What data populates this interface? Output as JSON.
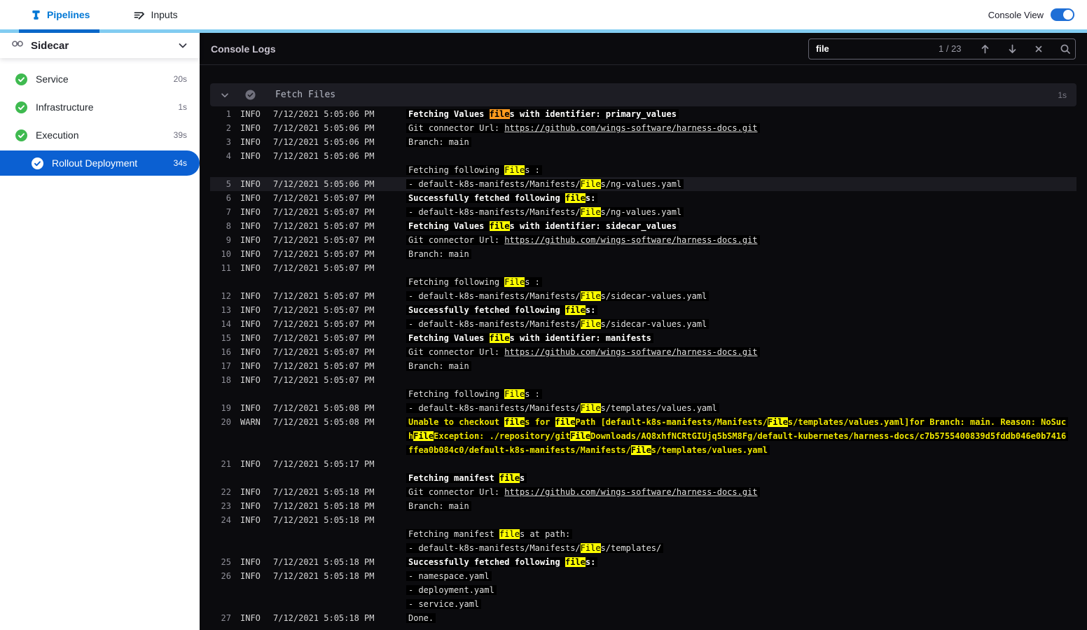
{
  "topnav": {
    "tabs": [
      {
        "label": "Pipelines",
        "active": true
      },
      {
        "label": "Inputs",
        "active": false
      }
    ],
    "console_view_label": "Console View",
    "console_view_on": true
  },
  "sidebar": {
    "stage_label": "Sidecar",
    "steps": [
      {
        "label": "Service",
        "duration": "20s",
        "status": "success",
        "selected": false
      },
      {
        "label": "Infrastructure",
        "duration": "1s",
        "status": "success",
        "selected": false
      },
      {
        "label": "Execution",
        "duration": "39s",
        "status": "success",
        "selected": false
      },
      {
        "label": "Rollout Deployment",
        "duration": "34s",
        "status": "success",
        "selected": true
      }
    ]
  },
  "console": {
    "title": "Console Logs",
    "search": {
      "value": "file",
      "counter": "1 / 23",
      "icons": [
        "arrow-up-icon",
        "arrow-down-icon",
        "close-icon",
        "search-icon"
      ]
    },
    "section": {
      "title": "Fetch Files",
      "duration": "1s",
      "status": "success"
    },
    "colors": {
      "accent_blue": "#0278d5",
      "selected_step_blue": "#0b60d2",
      "success_green": "#3fba50",
      "console_bg": "#0b0b0e",
      "match_highlight_bg": "#ffff00",
      "current_match_bg": "#ff9a1e",
      "warn_text": "#efe600",
      "strip_light_blue": "#83cdf2",
      "strip_active_blue": "#0b68ca"
    },
    "lines": [
      {
        "n": 1,
        "lvl": "INFO",
        "t": "7/12/2021 5:05:06 PM",
        "rows": [
          {
            "b": 1,
            "parts": [
              "Fetching Values ",
              {
                "t": "file",
                "h": "c"
              },
              "s with identifier: primary_values"
            ]
          }
        ]
      },
      {
        "n": 2,
        "lvl": "INFO",
        "t": "7/12/2021 5:05:06 PM",
        "rows": [
          {
            "parts": [
              "Git connector Url: ",
              {
                "t": "https://github.com/wings-software/harness-docs.git",
                "l": 1
              }
            ]
          }
        ]
      },
      {
        "n": 3,
        "lvl": "INFO",
        "t": "7/12/2021 5:05:06 PM",
        "rows": [
          {
            "parts": [
              "Branch: main"
            ]
          }
        ]
      },
      {
        "n": 4,
        "lvl": "INFO",
        "t": "7/12/2021 5:05:06 PM",
        "rows": [
          {
            "parts": []
          },
          {
            "parts": [
              "Fetching following ",
              {
                "t": "File",
                "h": "m"
              },
              "s :"
            ]
          }
        ]
      },
      {
        "n": 5,
        "lvl": "INFO",
        "t": "7/12/2021 5:05:06 PM",
        "sel": 1,
        "rows": [
          {
            "parts": [
              "- default-k8s-manifests/Manifests/",
              {
                "t": "File",
                "h": "m"
              },
              "s/ng-values.yaml"
            ]
          }
        ]
      },
      {
        "n": 6,
        "lvl": "INFO",
        "t": "7/12/2021 5:05:07 PM",
        "rows": [
          {
            "b": 1,
            "parts": [
              "Successfully fetched following ",
              {
                "t": "file",
                "h": "m"
              },
              "s:"
            ]
          }
        ]
      },
      {
        "n": 7,
        "lvl": "INFO",
        "t": "7/12/2021 5:05:07 PM",
        "rows": [
          {
            "parts": [
              "- default-k8s-manifests/Manifests/",
              {
                "t": "File",
                "h": "m"
              },
              "s/ng-values.yaml"
            ]
          }
        ]
      },
      {
        "n": 8,
        "lvl": "INFO",
        "t": "7/12/2021 5:05:07 PM",
        "rows": [
          {
            "b": 1,
            "parts": [
              "Fetching Values ",
              {
                "t": "file",
                "h": "m"
              },
              "s with identifier: sidecar_values"
            ]
          }
        ]
      },
      {
        "n": 9,
        "lvl": "INFO",
        "t": "7/12/2021 5:05:07 PM",
        "rows": [
          {
            "parts": [
              "Git connector Url: ",
              {
                "t": "https://github.com/wings-software/harness-docs.git",
                "l": 1
              }
            ]
          }
        ]
      },
      {
        "n": 10,
        "lvl": "INFO",
        "t": "7/12/2021 5:05:07 PM",
        "rows": [
          {
            "parts": [
              "Branch: main"
            ]
          }
        ]
      },
      {
        "n": 11,
        "lvl": "INFO",
        "t": "7/12/2021 5:05:07 PM",
        "rows": [
          {
            "parts": []
          },
          {
            "parts": [
              "Fetching following ",
              {
                "t": "File",
                "h": "m"
              },
              "s :"
            ]
          }
        ]
      },
      {
        "n": 12,
        "lvl": "INFO",
        "t": "7/12/2021 5:05:07 PM",
        "rows": [
          {
            "parts": [
              "- default-k8s-manifests/Manifests/",
              {
                "t": "File",
                "h": "m"
              },
              "s/sidecar-values.yaml"
            ]
          }
        ]
      },
      {
        "n": 13,
        "lvl": "INFO",
        "t": "7/12/2021 5:05:07 PM",
        "rows": [
          {
            "b": 1,
            "parts": [
              "Successfully fetched following ",
              {
                "t": "file",
                "h": "m"
              },
              "s:"
            ]
          }
        ]
      },
      {
        "n": 14,
        "lvl": "INFO",
        "t": "7/12/2021 5:05:07 PM",
        "rows": [
          {
            "parts": [
              "- default-k8s-manifests/Manifests/",
              {
                "t": "File",
                "h": "m"
              },
              "s/sidecar-values.yaml"
            ]
          }
        ]
      },
      {
        "n": 15,
        "lvl": "INFO",
        "t": "7/12/2021 5:05:07 PM",
        "rows": [
          {
            "b": 1,
            "parts": [
              "Fetching Values ",
              {
                "t": "file",
                "h": "m"
              },
              "s with identifier: manifests"
            ]
          }
        ]
      },
      {
        "n": 16,
        "lvl": "INFO",
        "t": "7/12/2021 5:05:07 PM",
        "rows": [
          {
            "parts": [
              "Git connector Url: ",
              {
                "t": "https://github.com/wings-software/harness-docs.git",
                "l": 1
              }
            ]
          }
        ]
      },
      {
        "n": 17,
        "lvl": "INFO",
        "t": "7/12/2021 5:05:07 PM",
        "rows": [
          {
            "parts": [
              "Branch: main"
            ]
          }
        ]
      },
      {
        "n": 18,
        "lvl": "INFO",
        "t": "7/12/2021 5:05:07 PM",
        "rows": [
          {
            "parts": []
          },
          {
            "parts": [
              "Fetching following ",
              {
                "t": "File",
                "h": "m"
              },
              "s :"
            ]
          }
        ]
      },
      {
        "n": 19,
        "lvl": "INFO",
        "t": "7/12/2021 5:05:08 PM",
        "rows": [
          {
            "parts": [
              "- default-k8s-manifests/Manifests/",
              {
                "t": "File",
                "h": "m"
              },
              "s/templates/values.yaml"
            ]
          }
        ]
      },
      {
        "n": 20,
        "lvl": "WARN",
        "t": "7/12/2021 5:05:08 PM",
        "rows": [
          {
            "w": 1,
            "parts": [
              "Unable to checkout ",
              {
                "t": "file",
                "h": "m"
              },
              "s for ",
              {
                "t": "file",
                "h": "m"
              },
              "Path [default-k8s-manifests/Manifests/",
              {
                "t": "File",
                "h": "m"
              },
              "s/templates/values.yaml]for Branch: main. Reason: NoSuch",
              {
                "t": "File",
                "h": "m"
              },
              "Exception: ./repository/git",
              {
                "t": "File",
                "h": "m"
              },
              "Downloads/AQ8xhfNCRtGIUjq5bSM8Fg/default-kubernetes/harness-docs/c7b5755400839d5fddb046e0b7416ffea0b084c0/default-k8s-manifests/Manifests/",
              {
                "t": "File",
                "h": "m"
              },
              "s/templates/values.yaml"
            ]
          }
        ]
      },
      {
        "n": 21,
        "lvl": "INFO",
        "t": "7/12/2021 5:05:17 PM",
        "rows": [
          {
            "parts": []
          },
          {
            "b": 1,
            "parts": [
              "Fetching manifest ",
              {
                "t": "file",
                "h": "m"
              },
              "s"
            ]
          }
        ]
      },
      {
        "n": 22,
        "lvl": "INFO",
        "t": "7/12/2021 5:05:18 PM",
        "rows": [
          {
            "parts": [
              "Git connector Url: ",
              {
                "t": "https://github.com/wings-software/harness-docs.git",
                "l": 1
              }
            ]
          }
        ]
      },
      {
        "n": 23,
        "lvl": "INFO",
        "t": "7/12/2021 5:05:18 PM",
        "rows": [
          {
            "parts": [
              "Branch: main"
            ]
          }
        ]
      },
      {
        "n": 24,
        "lvl": "INFO",
        "t": "7/12/2021 5:05:18 PM",
        "rows": [
          {
            "parts": []
          },
          {
            "parts": [
              "Fetching manifest ",
              {
                "t": "file",
                "h": "m"
              },
              "s at path:"
            ]
          },
          {
            "parts": [
              "- default-k8s-manifests/Manifests/",
              {
                "t": "File",
                "h": "m"
              },
              "s/templates/"
            ]
          }
        ]
      },
      {
        "n": 25,
        "lvl": "INFO",
        "t": "7/12/2021 5:05:18 PM",
        "rows": [
          {
            "b": 1,
            "parts": [
              "Successfully fetched following ",
              {
                "t": "file",
                "h": "m"
              },
              "s:"
            ]
          }
        ]
      },
      {
        "n": 26,
        "lvl": "INFO",
        "t": "7/12/2021 5:05:18 PM",
        "rows": [
          {
            "parts": [
              "- namespace.yaml"
            ]
          },
          {
            "parts": [
              "- deployment.yaml"
            ]
          },
          {
            "parts": [
              "- service.yaml"
            ]
          }
        ]
      },
      {
        "n": 27,
        "lvl": "INFO",
        "t": "7/12/2021 5:05:18 PM",
        "rows": [
          {
            "parts": [
              "Done."
            ]
          }
        ]
      }
    ]
  }
}
